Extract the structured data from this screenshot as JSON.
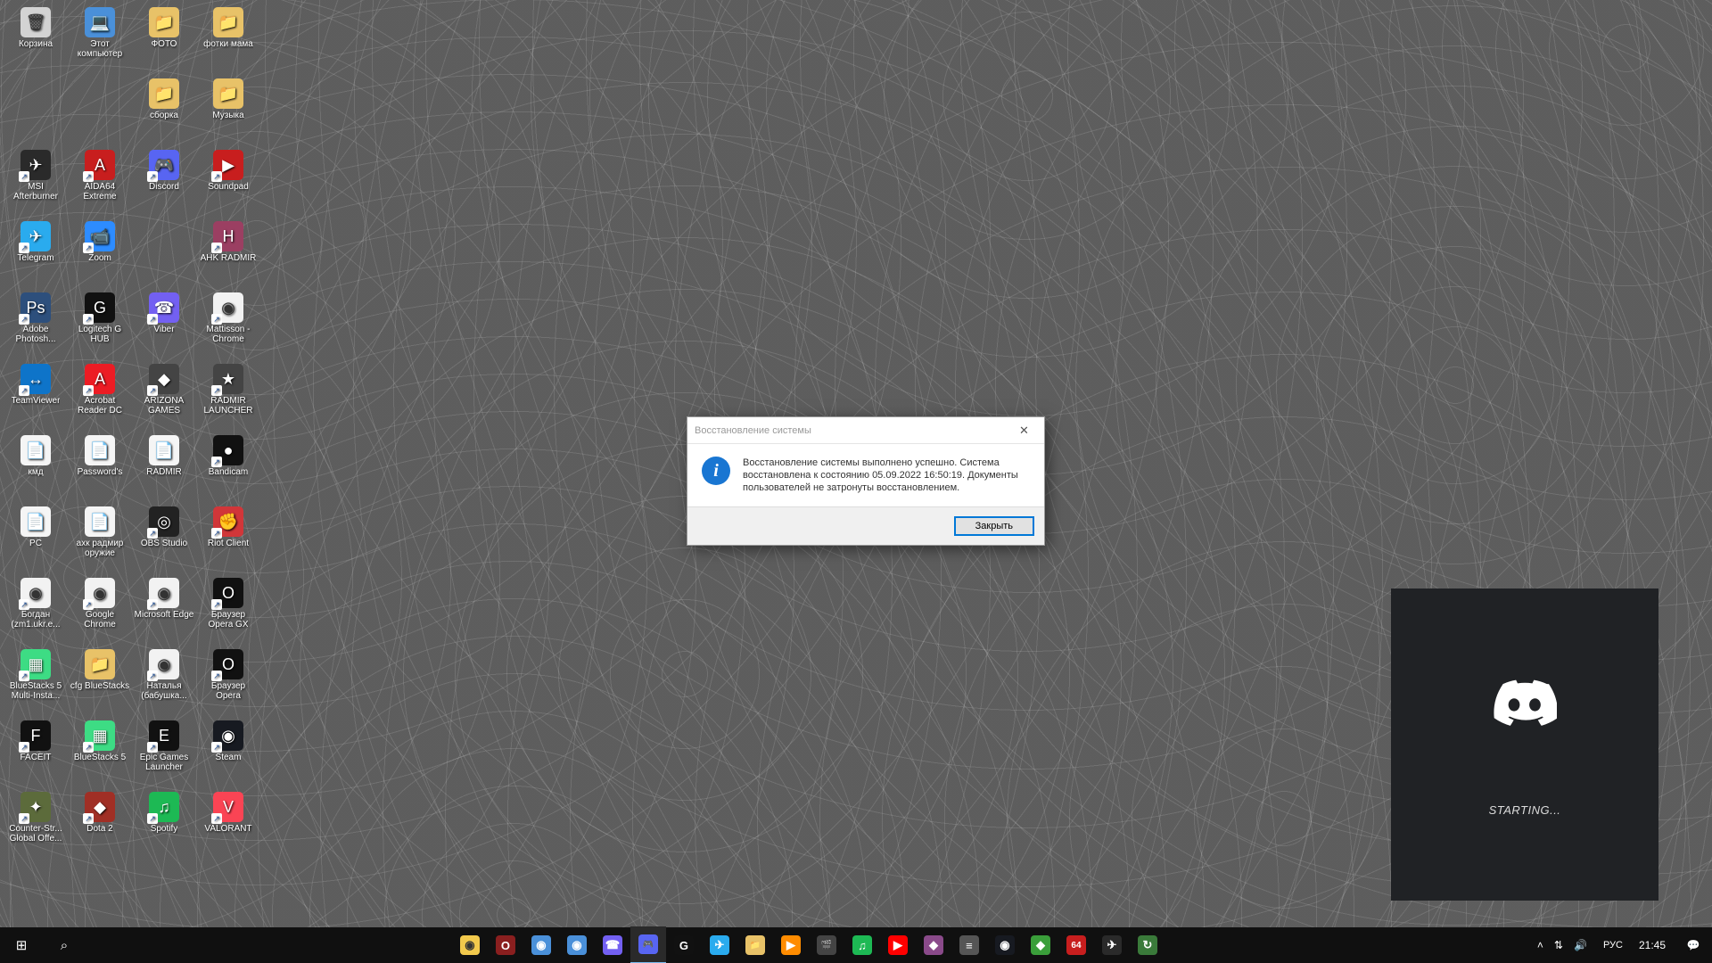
{
  "desktop": {
    "columns": [
      [
        "Корзина",
        "Этот компьютер",
        "ФОТО",
        "фотки мама"
      ],
      [
        "",
        "",
        "сборка",
        "Музыка"
      ],
      [
        "MSI Afterburner",
        "AIDA64 Extreme",
        "Discord",
        "Soundpad"
      ],
      [
        "Telegram",
        "Zoom",
        "",
        "AHK RADMIR"
      ],
      [
        "Adobe Photosh...",
        "Logitech G HUB",
        "Viber",
        "Mattisson - Chrome"
      ],
      [
        "TeamViewer",
        "Acrobat Reader DC",
        "ARIZONA GAMES",
        "RADMIR LAUNCHER"
      ],
      [
        "кмд",
        "Password's",
        "RADMIR",
        "Bandicam"
      ],
      [
        "PC",
        "ахк радмир оружие",
        "OBS Studio",
        "Riot Client"
      ],
      [
        "Богдан (zm1.ukr.e...",
        "Google Chrome",
        "Microsoft Edge",
        "Браузер Opera GX"
      ],
      [
        "BlueStacks 5 Multi-Insta...",
        "cfg BlueStacks",
        "Наталья (бабушка...",
        "Браузер Opera"
      ],
      [
        "FACEIT",
        "BlueStacks 5",
        "Epic Games Launcher",
        "Steam"
      ],
      [
        "Counter-Str... Global Offe...",
        "Dota 2",
        "Spotify",
        "VALORANT"
      ]
    ],
    "icon_colors": {
      "Корзина": "#d3d3d3",
      "Этот компьютер": "#4a90d9",
      "ФОТО": "#e8c268",
      "фотки мама": "#e8c268",
      "сборка": "#e8c268",
      "Музыка": "#e8c268",
      "MSI Afterburner": "#2a2a2a",
      "AIDA64 Extreme": "#c81e1e",
      "Discord": "#5865F2",
      "Soundpad": "#c81e1e",
      "Telegram": "#2AABEE",
      "Zoom": "#2D8CFF",
      "AHK RADMIR": "#9b3f62",
      "Adobe Photosh...": "#2d4f7c",
      "Logitech G HUB": "#111",
      "Viber": "#7360F2",
      "Mattisson - Chrome": "#f2f2f2",
      "TeamViewer": "#0e74c9",
      "Acrobat Reader DC": "#ec1c24",
      "ARIZONA GAMES": "#444",
      "RADMIR LAUNCHER": "#444",
      "кмд": "#f5f5f5",
      "Password's": "#f5f5f5",
      "RADMIR": "#f5f5f5",
      "Bandicam": "#111",
      "PC": "#f5f5f5",
      "ахк радмир оружие": "#f5f5f5",
      "OBS Studio": "#222",
      "Riot Client": "#d13639",
      "Богдан (zm1.ukr.e...": "#f2f2f2",
      "Google Chrome": "#f2f2f2",
      "Microsoft Edge": "#f2f2f2",
      "Браузер Opera GX": "#111",
      "BlueStacks 5 Multi-Insta...": "#3ddc84",
      "cfg BlueStacks": "#e8c268",
      "Наталья (бабушка...": "#f2f2f2",
      "Браузер Opera": "#111",
      "FACEIT": "#111",
      "BlueStacks 5": "#3ddc84",
      "Epic Games Launcher": "#111",
      "Steam": "#171a21",
      "Counter-Str... Global Offe...": "#5c6b3b",
      "Dota 2": "#a02f25",
      "Spotify": "#1DB954",
      "VALORANT": "#fa4454"
    },
    "icon_emoji": {
      "Корзина": "🗑",
      "Этот компьютер": "💻",
      "ФОТО": "📁",
      "фотки мама": "📁",
      "сборка": "📁",
      "Музыка": "📁",
      "MSI Afterburner": "✈",
      "AIDA64 Extreme": "A",
      "Discord": "🎮",
      "Soundpad": "▶",
      "Telegram": "✈",
      "Zoom": "📹",
      "AHK RADMIR": "H",
      "Adobe Photosh...": "Ps",
      "Logitech G HUB": "G",
      "Viber": "☎",
      "Mattisson - Chrome": "◉",
      "TeamViewer": "↔",
      "Acrobat Reader DC": "A",
      "ARIZONA GAMES": "◆",
      "RADMIR LAUNCHER": "★",
      "кмд": "📄",
      "Password's": "📄",
      "RADMIR": "📄",
      "Bandicam": "●",
      "PC": "📄",
      "ахк радмир оружие": "📄",
      "OBS Studio": "◎",
      "Riot Client": "✊",
      "Богдан (zm1.ukr.e...": "◉",
      "Google Chrome": "◉",
      "Microsoft Edge": "◉",
      "Браузер Opera GX": "O",
      "BlueStacks 5 Multi-Insta...": "▦",
      "cfg BlueStacks": "📁",
      "Наталья (бабушка...": "◉",
      "Браузер Opera": "O",
      "FACEIT": "F",
      "BlueStacks 5": "▦",
      "Epic Games Launcher": "E",
      "Steam": "◉",
      "Counter-Str... Global Offe...": "✦",
      "Dota 2": "◆",
      "Spotify": "♫",
      "VALORANT": "V"
    }
  },
  "dialog": {
    "title": "Восстановление системы",
    "message": "Восстановление системы выполнено успешно. Система восстановлена к состоянию 05.09.2022 16:50:19. Документы пользователей не затронуты восстановлением.",
    "button": "Закрыть"
  },
  "discord_splash": {
    "text": "STARTING..."
  },
  "taskbar": {
    "apps": [
      {
        "name": "chrome",
        "color": "#f2c94c",
        "glyph": "◉"
      },
      {
        "name": "opera-gx",
        "color": "#8a1f1f",
        "glyph": "O"
      },
      {
        "name": "chrome-2",
        "color": "#4a90d9",
        "glyph": "◉"
      },
      {
        "name": "chrome-3",
        "color": "#4a90d9",
        "glyph": "◉"
      },
      {
        "name": "viber",
        "color": "#7360F2",
        "glyph": "☎"
      },
      {
        "name": "discord",
        "color": "#5865F2",
        "glyph": "🎮",
        "active": true
      },
      {
        "name": "logitech",
        "color": "#111",
        "glyph": "G"
      },
      {
        "name": "telegram",
        "color": "#2AABEE",
        "glyph": "✈"
      },
      {
        "name": "explorer",
        "color": "#e8c268",
        "glyph": "📁"
      },
      {
        "name": "media",
        "color": "#ff8c00",
        "glyph": "▶"
      },
      {
        "name": "movies",
        "color": "#444",
        "glyph": "🎬"
      },
      {
        "name": "spotify",
        "color": "#1DB954",
        "glyph": "♫"
      },
      {
        "name": "youtube",
        "color": "#ff0000",
        "glyph": "▶"
      },
      {
        "name": "app1",
        "color": "#8a4a8a",
        "glyph": "◆"
      },
      {
        "name": "app2",
        "color": "#555",
        "glyph": "≡"
      },
      {
        "name": "steam",
        "color": "#171a21",
        "glyph": "◉"
      },
      {
        "name": "app3",
        "color": "#3a9e3a",
        "glyph": "◆"
      },
      {
        "name": "aida64",
        "color": "#c81e1e",
        "glyph": "64"
      },
      {
        "name": "msi",
        "color": "#2a2a2a",
        "glyph": "✈"
      },
      {
        "name": "restore",
        "color": "#3a7a3a",
        "glyph": "↻"
      }
    ],
    "tray": {
      "lang": "РУС",
      "time": "21:45"
    }
  }
}
